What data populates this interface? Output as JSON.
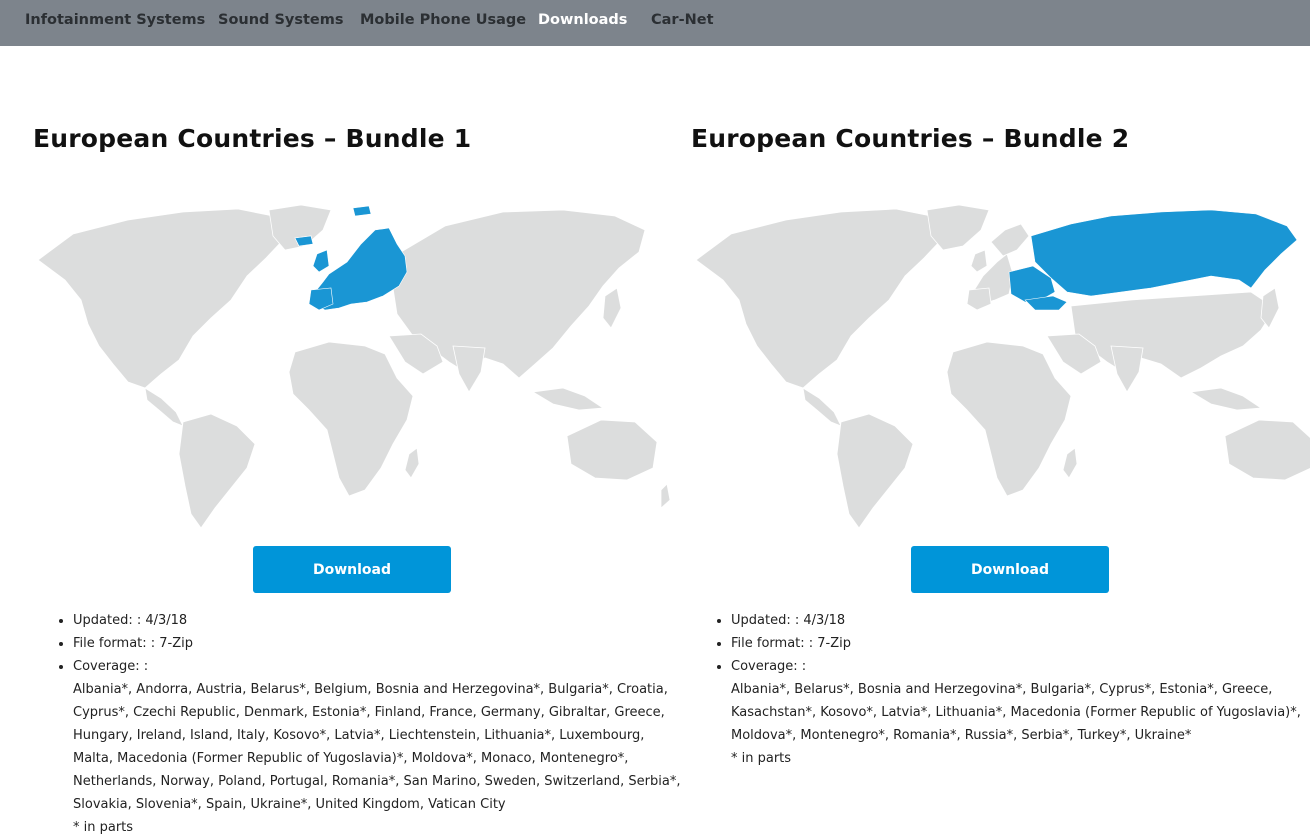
{
  "nav": {
    "items": [
      {
        "label": "Infotainment Systems",
        "active": false
      },
      {
        "label": "Sound Systems",
        "active": false
      },
      {
        "label": "Mobile Phone Usage",
        "active": false
      },
      {
        "label": "Downloads",
        "active": true
      },
      {
        "label": "Car-Net",
        "active": false
      }
    ]
  },
  "colors": {
    "nav_bg": "#7d848c",
    "nav_active": "#ffffff",
    "land": "#dcdddd",
    "highlight": "#1a96d4",
    "button": "#0095d9"
  },
  "bundles": [
    {
      "title": "European Countries – Bundle 1",
      "map_icon": "world-map-europe-highlight",
      "download_label": "Download",
      "updated": "Updated: : 4/3/18",
      "file_format": "File format: : 7-Zip",
      "coverage_label": "Coverage: :",
      "coverage_lines": [
        "Albania*, Andorra, Austria, Belarus*, Belgium, Bosnia and Herzegovina*, Bulgaria*, Croatia,",
        "Cyprus*, Czechi Republic, Denmark, Estonia*, Finland, France, Germany, Gibraltar, Greece,",
        "Hungary, Ireland, Island, Italy, Kosovo*, Latvia*, Liechtenstein, Lithuania*, Luxembourg,",
        "Malta, Macedonia (Former Republic of Yugoslavia)*, Moldova*, Monaco, Montenegro*,",
        "Netherlands, Norway, Poland, Portugal, Romania*, San Marino, Sweden, Switzerland, Serbia*,",
        "Slovakia, Slovenia*, Spain, Ukraine*, United Kingdom, Vatican City"
      ],
      "note": "* in parts"
    },
    {
      "title": "European Countries – Bundle 2",
      "map_icon": "world-map-eastern-europe-russia-highlight",
      "download_label": "Download",
      "updated": "Updated: : 4/3/18",
      "file_format": "File format: : 7-Zip",
      "coverage_label": "Coverage: :",
      "coverage_lines": [
        "Albania*, Belarus*, Bosnia and Herzegovina*, Bulgaria*, Cyprus*, Estonia*, Greece,",
        "Kasachstan*, Kosovo*, Latvia*, Lithuania*, Macedonia (Former Republic of Yugoslavia)*,",
        "Moldova*, Montenegro*, Romania*, Russia*, Serbia*, Turkey*, Ukraine*"
      ],
      "note": "* in parts"
    }
  ]
}
